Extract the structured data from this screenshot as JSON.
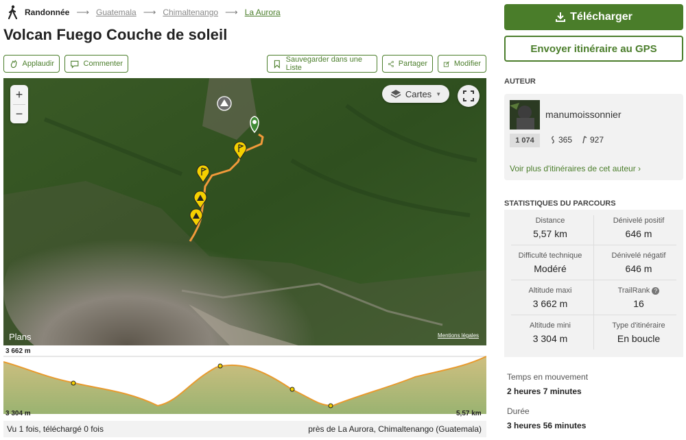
{
  "breadcrumb": {
    "root": "Randonnée",
    "items": [
      "Guatemala",
      "Chimaltenango",
      "La Aurora"
    ]
  },
  "page_title": "Volcan Fuego Couche de soleil",
  "actions": {
    "applaud": "Applaudir",
    "comment": "Commenter",
    "save_list": "Sauvegarder dans une Liste",
    "share": "Partager",
    "edit": "Modifier"
  },
  "map": {
    "layers_label": "Cartes",
    "zoom_in": "+",
    "zoom_out": "−",
    "brand": "Plans",
    "legal": "Mentions légales"
  },
  "elevation": {
    "max": "3 662 m",
    "min": "3 304 m",
    "distance": "5,57 km"
  },
  "footer": {
    "views": "Vu 1 fois, téléchargé 0 fois",
    "location": "près de La Aurora, Chimaltenango (Guatemala)"
  },
  "download_label": "Télécharger",
  "gps_label": "Envoyer itinéraire au GPS",
  "author": {
    "heading": "AUTEUR",
    "name": "manumoissonnier",
    "rank": "1 074",
    "trails": "365",
    "followers": "927",
    "more_link": "Voir plus d'itinéraires de cet auteur ›"
  },
  "stats": {
    "heading": "STATISTIQUES DU PARCOURS",
    "distance_label": "Distance",
    "distance": "5,57 km",
    "gain_label": "Dénivelé positif",
    "gain": "646 m",
    "difficulty_label": "Difficulté technique",
    "difficulty": "Modéré",
    "loss_label": "Dénivelé négatif",
    "loss": "646 m",
    "alt_max_label": "Altitude maxi",
    "alt_max": "3 662 m",
    "trailrank_label": "TrailRank",
    "trailrank": "16",
    "alt_min_label": "Altitude mini",
    "alt_min": "3 304 m",
    "type_label": "Type d'itinéraire",
    "type": "En boucle"
  },
  "moving_time_label": "Temps en mouvement",
  "moving_time": "2 heures 7 minutes",
  "duration_label": "Durée",
  "duration": "3 heures 56 minutes",
  "colors": {
    "accent": "#4a7d2a",
    "track": "#f29a3a",
    "waypoint": "#f5d000"
  }
}
